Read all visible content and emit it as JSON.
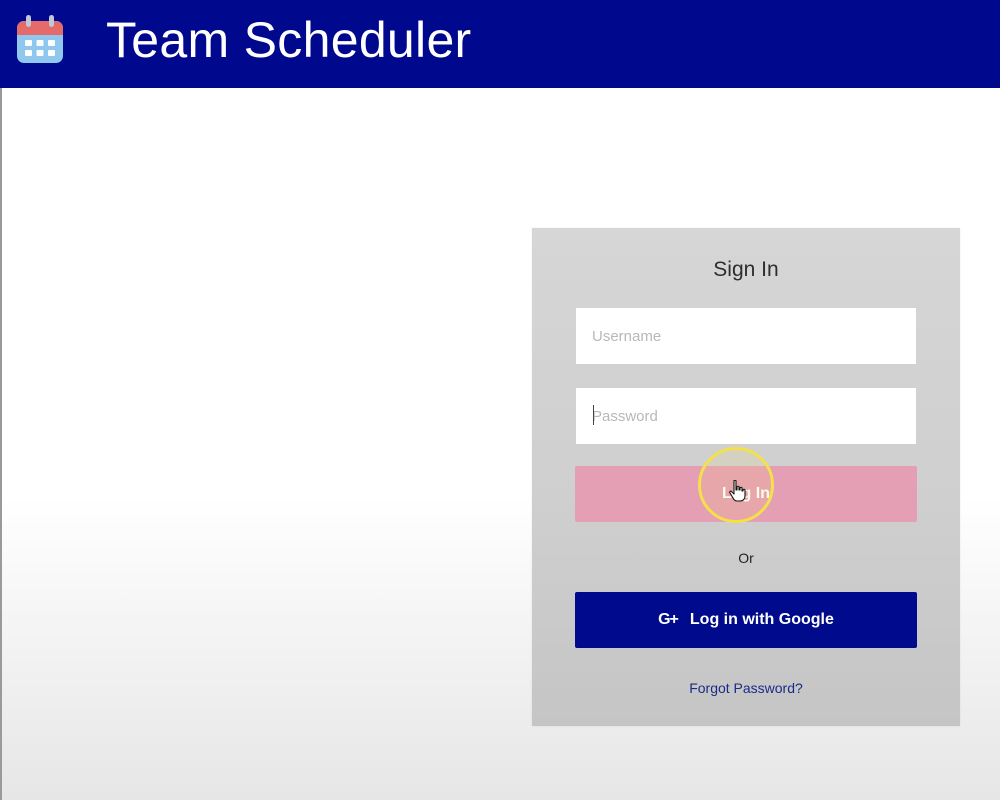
{
  "header": {
    "title": "Team Scheduler",
    "logo_icon": "calendar-icon",
    "background": "#00098e"
  },
  "signin": {
    "title": "Sign In",
    "username": {
      "placeholder": "Username",
      "value": ""
    },
    "password": {
      "placeholder": "Password",
      "value": ""
    },
    "login_label": "Log In",
    "or_label": "Or",
    "google_icon": "G+",
    "google_label": "Log in with Google",
    "forgot_label": "Forgot Password?"
  },
  "colors": {
    "accent": "#00098e",
    "login_button": "#e59fb5",
    "google_button": "#000a8c",
    "link": "#1a2a8a",
    "click_highlight": "#f3e04a"
  }
}
